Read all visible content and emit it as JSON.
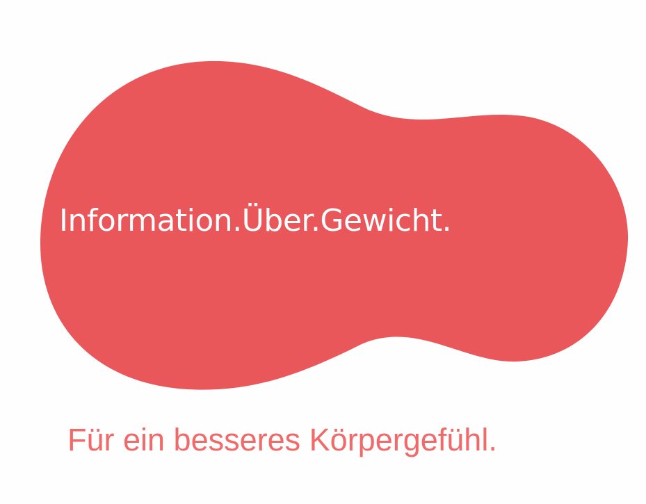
{
  "logo": {
    "headline": "Information.Über.Gewicht.",
    "tagline": "Für ein besseres Körpergefühl.",
    "blob_color": "#e9575a",
    "headline_color": "#ffffff",
    "tagline_color": "#ef6a68",
    "background_color": "#fefefe"
  }
}
